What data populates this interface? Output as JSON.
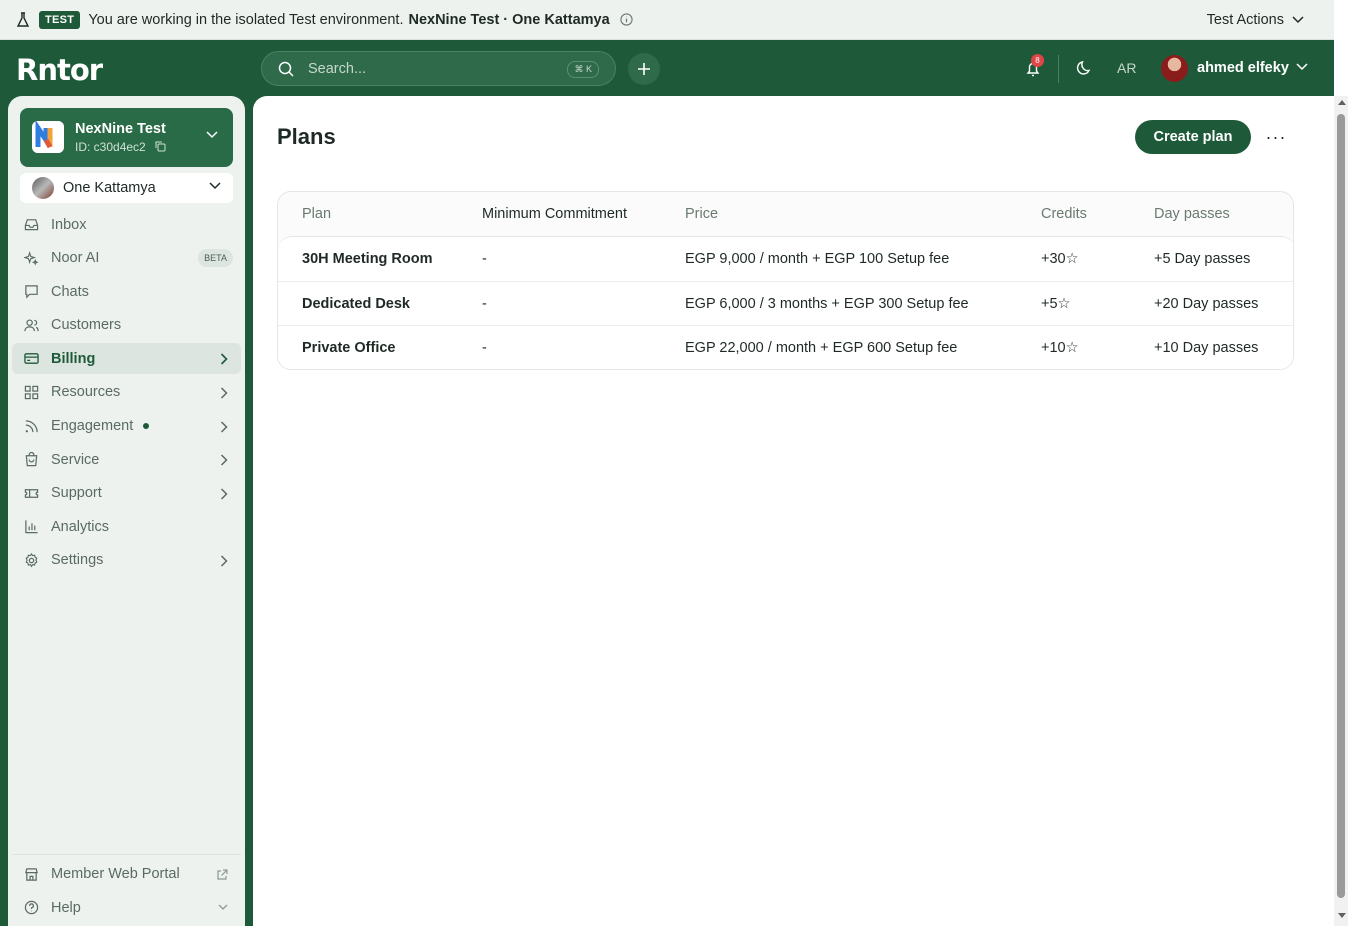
{
  "banner": {
    "badge": "TEST",
    "message": "You are working in the isolated Test environment.",
    "environment": "NexNine Test · One Kattamya",
    "actions_label": "Test Actions"
  },
  "header": {
    "logo": "Rntor",
    "search_placeholder": "Search...",
    "search_shortcut": "⌘ K",
    "notification_count": "8",
    "language": "AR",
    "user_name": "ahmed elfeky"
  },
  "org": {
    "name": "NexNine Test",
    "id": "ID: c30d4ec2"
  },
  "location": {
    "name": "One Kattamya"
  },
  "sidebar": {
    "items": [
      {
        "label": "Inbox"
      },
      {
        "label": "Noor AI",
        "badge": "BETA"
      },
      {
        "label": "Chats"
      },
      {
        "label": "Customers"
      },
      {
        "label": "Billing"
      },
      {
        "label": "Resources"
      },
      {
        "label": "Engagement"
      },
      {
        "label": "Service"
      },
      {
        "label": "Support"
      },
      {
        "label": "Analytics"
      },
      {
        "label": "Settings"
      }
    ],
    "bottom": [
      {
        "label": "Member Web Portal"
      },
      {
        "label": "Help"
      }
    ]
  },
  "main": {
    "title": "Plans",
    "create_label": "Create plan",
    "more_label": "···",
    "columns": [
      "Plan",
      "Minimum Commitment",
      "Price",
      "Credits",
      "Day passes"
    ],
    "rows": [
      {
        "plan": "30H Meeting Room",
        "min": "-",
        "price": "EGP 9,000 / month + EGP 100 Setup fee",
        "credits": "+30☆",
        "day": "+5 Day passes"
      },
      {
        "plan": "Dedicated Desk",
        "min": "-",
        "price": "EGP 6,000 / 3 months + EGP 300 Setup fee",
        "credits": "+5☆",
        "day": "+20 Day passes"
      },
      {
        "plan": "Private Office",
        "min": "-",
        "price": "EGP 22,000 / month + EGP 600 Setup fee",
        "credits": "+10☆",
        "day": "+10 Day passes"
      }
    ]
  },
  "colors": {
    "brand": "#1e5a3a",
    "sidebar_bg": "#eef2ef",
    "badge_red": "#e04545"
  }
}
